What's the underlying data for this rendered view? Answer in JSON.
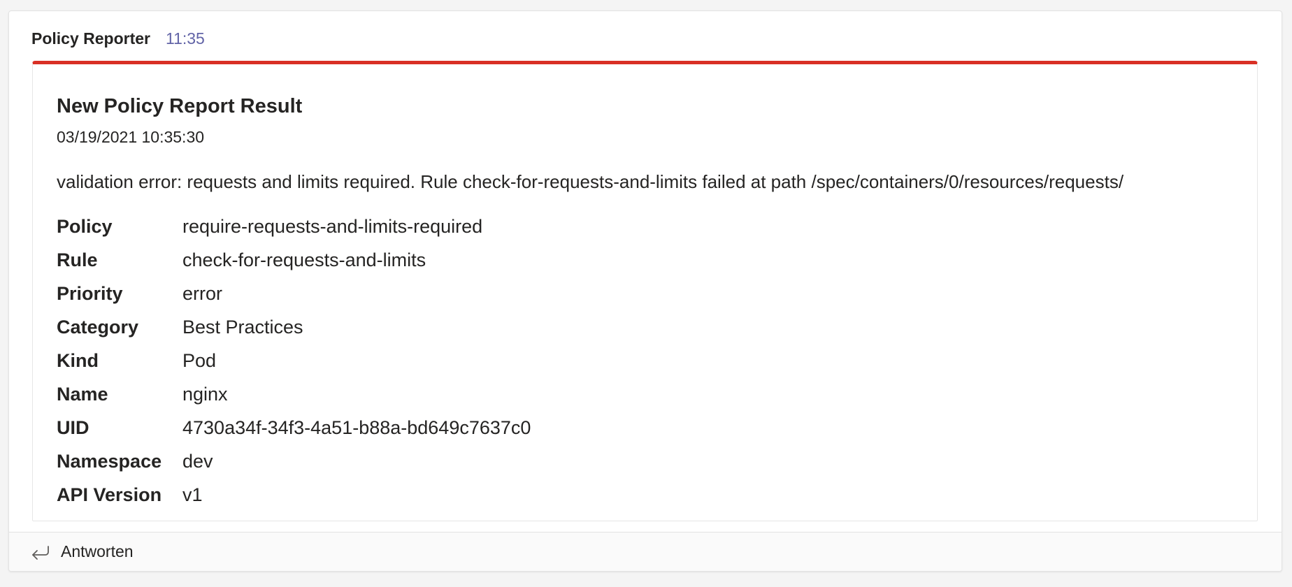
{
  "message": {
    "sender": "Policy Reporter",
    "time": "11:35"
  },
  "card": {
    "accent_color": "#d93025",
    "title": "New Policy Report Result",
    "date": "03/19/2021 10:35:30",
    "message": "validation error: requests and limits required. Rule check-for-requests-and-limits failed at path /spec/containers/0/resources/requests/",
    "facts": [
      {
        "label": "Policy",
        "value": "require-requests-and-limits-required"
      },
      {
        "label": "Rule",
        "value": "check-for-requests-and-limits"
      },
      {
        "label": "Priority",
        "value": "error"
      },
      {
        "label": "Category",
        "value": "Best Practices"
      },
      {
        "label": "Kind",
        "value": "Pod"
      },
      {
        "label": "Name",
        "value": "nginx"
      },
      {
        "label": "UID",
        "value": "4730a34f-34f3-4a51-b88a-bd649c7637c0"
      },
      {
        "label": "Namespace",
        "value": "dev"
      },
      {
        "label": "API Version",
        "value": "v1"
      }
    ]
  },
  "footer": {
    "reply_icon": "reply-arrow-icon",
    "reply_label": "Antworten"
  }
}
